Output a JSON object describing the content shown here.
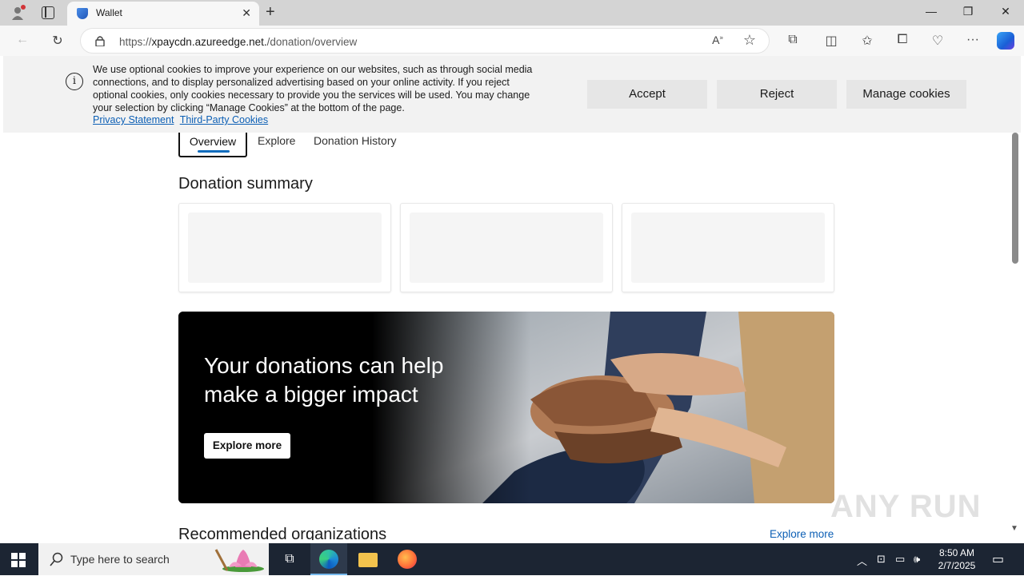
{
  "browser": {
    "tab_title": "Wallet",
    "url_prefix": "https://",
    "url_host": "xpaycdn.azureedge.net.",
    "url_path": "/donation/overview"
  },
  "cookie_banner": {
    "text": "We use optional cookies to improve your experience on our websites, such as through social media connections, and to display personalized advertising based on your online activity. If you reject optional cookies, only cookies necessary to provide you the services will be used. You may change your selection by clicking “Manage Cookies” at the bottom of the page.",
    "privacy_link": "Privacy Statement",
    "third_party_link": "Third-Party Cookies",
    "accept_label": "Accept",
    "reject_label": "Reject",
    "manage_label": "Manage cookies"
  },
  "nav": {
    "tabs": [
      {
        "label": "Overview"
      },
      {
        "label": "Explore"
      },
      {
        "label": "Donation History"
      }
    ]
  },
  "summary": {
    "title": "Donation summary"
  },
  "hero": {
    "title": "Your donations can help make a bigger impact",
    "button_label": "Explore more"
  },
  "recommended": {
    "title": "Recommended organizations",
    "link_label": "Explore more"
  },
  "watermark": "ANY RUN",
  "taskbar": {
    "search_placeholder": "Type here to search",
    "time": "8:50 AM",
    "date": "2/7/2025"
  },
  "colors": {
    "accent": "#0f6cbd",
    "link": "#0c5fb5",
    "taskbar": "#1c2533"
  }
}
